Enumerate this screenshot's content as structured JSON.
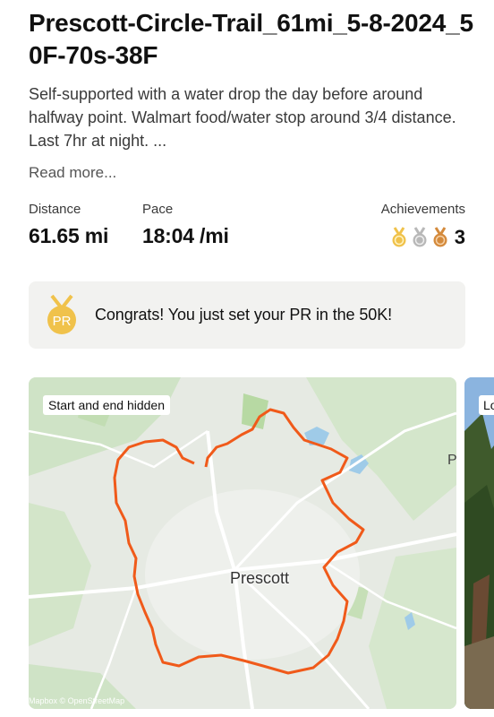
{
  "activity": {
    "title": "Prescott-Circle-Trail_61mi_5-8-2024_50F-70s-38F",
    "description": "Self-supported with a water drop the day before around halfway point. Walmart food/water stop around 3/4 distance. Last 7hr at night. ...",
    "read_more": "Read more..."
  },
  "stats": {
    "distance": {
      "label": "Distance",
      "value": "61.65 mi"
    },
    "pace": {
      "label": "Pace",
      "value": "18:04 /mi"
    },
    "achievements": {
      "label": "Achievements",
      "count": "3",
      "medals": [
        "gold-medal-icon",
        "silver-medal-icon",
        "bronze-medal-icon"
      ]
    }
  },
  "pr_banner": {
    "icon": "pr-medal-icon",
    "icon_text": "PR",
    "text": "Congrats! You just set your PR in the 50K!"
  },
  "map": {
    "badge": "Start and end hidden",
    "city_label": "Prescott",
    "attribution": "Mapbox © OpenStreetMap",
    "edge_label": "P",
    "route_color": "#f05a1a"
  },
  "photo": {
    "badge": "Lo"
  },
  "colors": {
    "gold": "#f0c24b",
    "silver": "#b8b8b8",
    "bronze": "#d48a3c",
    "route": "#f05a1a"
  }
}
